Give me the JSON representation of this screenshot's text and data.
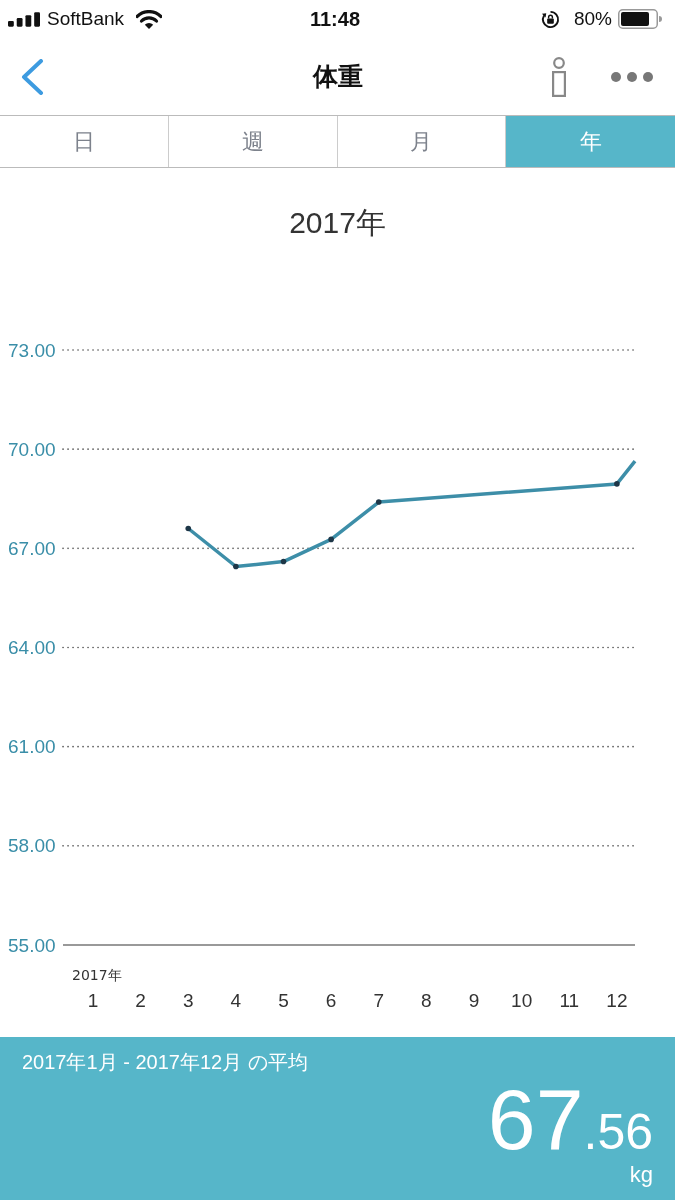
{
  "status_bar": {
    "carrier": "SoftBank",
    "time": "11:48",
    "battery": "80%"
  },
  "nav": {
    "title": "体重"
  },
  "tabs": [
    {
      "label": "日",
      "selected": false
    },
    {
      "label": "週",
      "selected": false
    },
    {
      "label": "月",
      "selected": false
    },
    {
      "label": "年",
      "selected": true
    }
  ],
  "chart": {
    "year_label": "2017年",
    "chart_data": {
      "type": "line",
      "title": "2017年",
      "x": [
        3,
        4,
        5,
        6,
        7,
        12,
        12.38
      ],
      "series": [
        {
          "color": "#3d8ea8",
          "values": [
            67.6,
            66.45,
            66.6,
            67.27,
            68.4,
            68.95,
            69.64
          ]
        }
      ],
      "xlim": [
        0.37,
        12.38
      ],
      "ylim": [
        55,
        73
      ],
      "grid": true,
      "xticks": [
        1,
        2,
        3,
        4,
        5,
        6,
        7,
        8,
        9,
        10,
        11,
        12
      ],
      "yticks": [
        {
          "value": 73,
          "label": "73.00"
        },
        {
          "value": 70,
          "label": "70.00"
        },
        {
          "value": 67,
          "label": "67.00"
        },
        {
          "value": 64,
          "label": "64.00"
        },
        {
          "value": 61,
          "label": "61.00"
        },
        {
          "value": 58,
          "label": "58.00"
        },
        {
          "value": 55,
          "label": "55.00"
        }
      ]
    }
  },
  "summary": {
    "period": "2017年1月 - 2017年12月 の平均",
    "value": "67.56",
    "unit": "kg"
  }
}
